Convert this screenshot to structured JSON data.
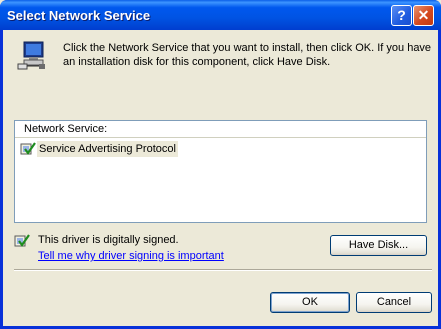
{
  "window": {
    "title": "Select Network Service",
    "help_icon": "help-icon",
    "close_icon": "close-icon"
  },
  "instructions": "Click the Network Service that you want to install, then click OK. If you have an installation disk for this component, click Have Disk.",
  "list": {
    "header": "Network Service:",
    "items": [
      {
        "label": "Service Advertising Protocol",
        "icon": "network-service-icon",
        "selected": true
      }
    ]
  },
  "signing": {
    "status": "This driver is digitally signed.",
    "link": "Tell me why driver signing is important",
    "icon": "signed-driver-icon"
  },
  "buttons": {
    "have_disk": "Have Disk...",
    "ok": "OK",
    "cancel": "Cancel"
  },
  "colors": {
    "title_bar": "#0058EE",
    "dialog_bg": "#ECE9D8",
    "link": "#0000FF",
    "close_button": "#D5491F"
  }
}
